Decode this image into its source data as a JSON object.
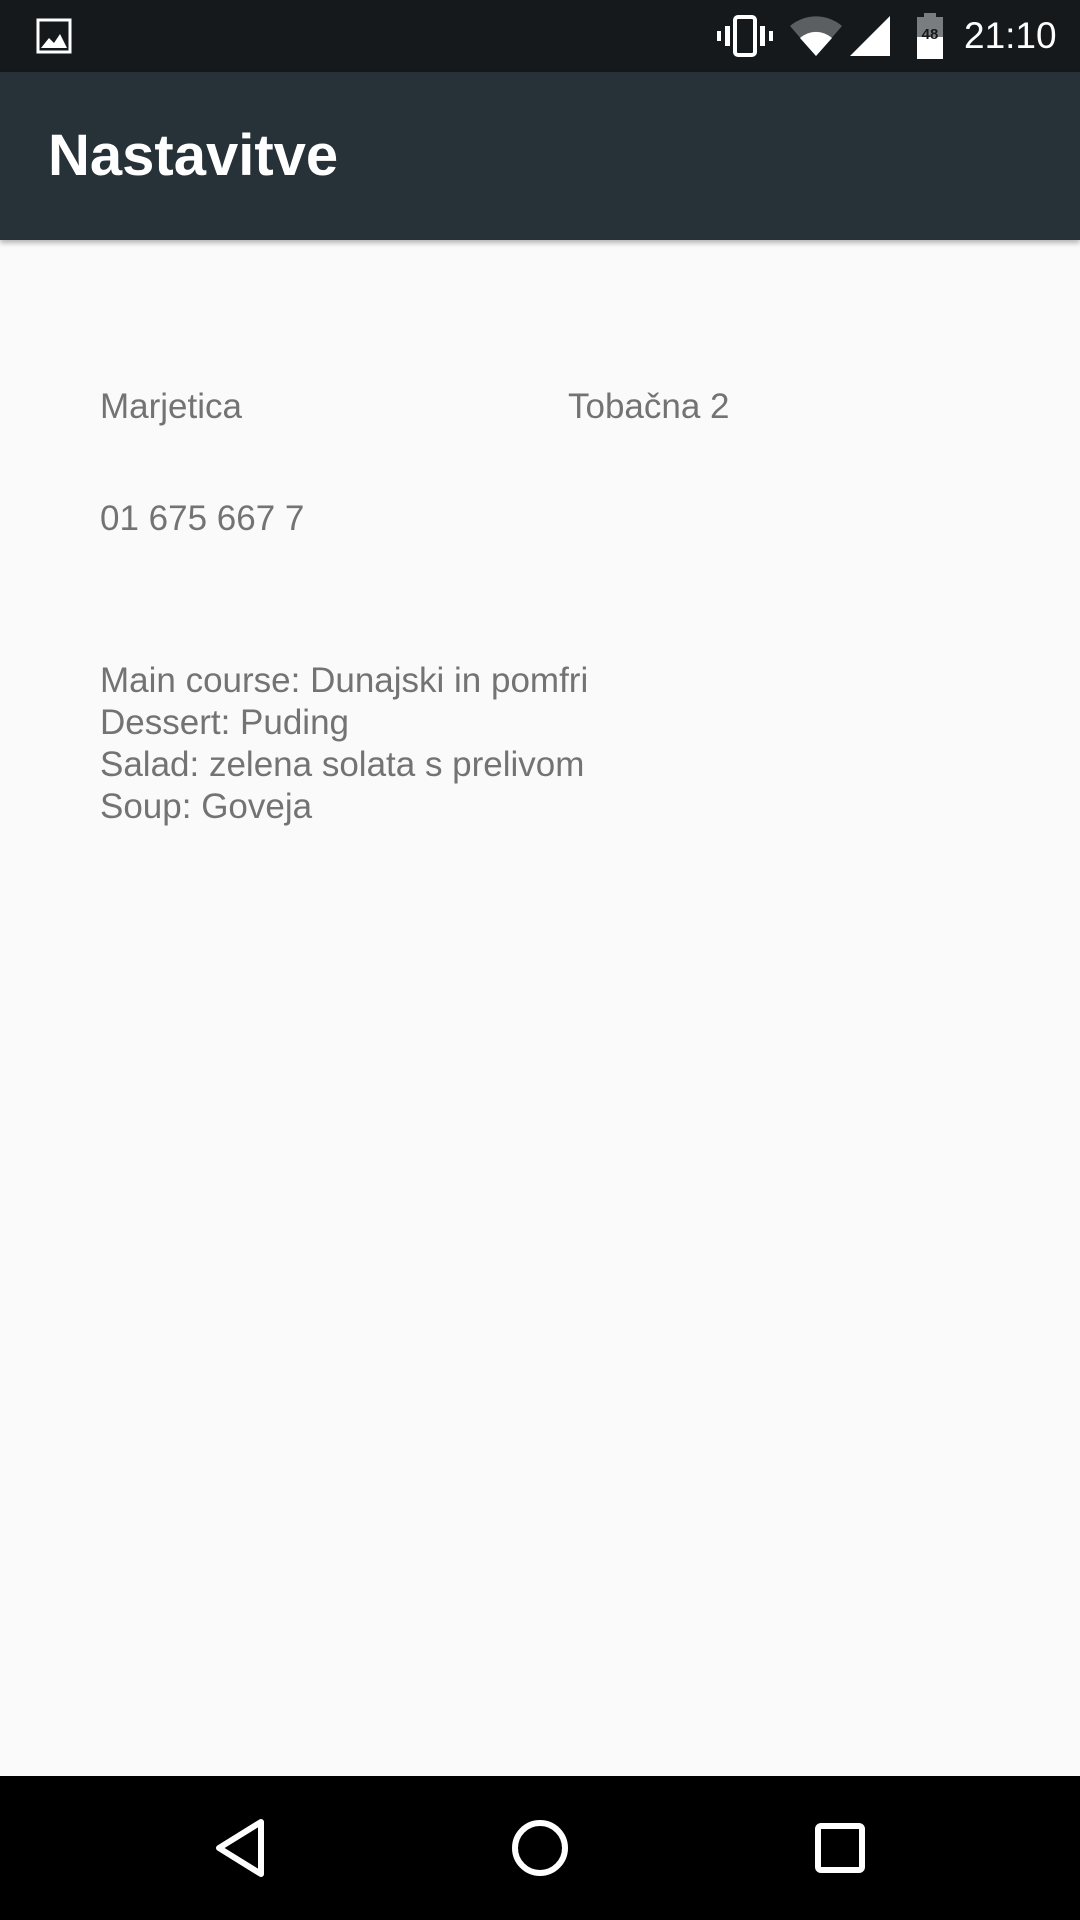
{
  "status_bar": {
    "time": "21:10",
    "battery_level": "48",
    "icons": [
      "gallery-icon",
      "vibrate-icon",
      "wifi-icon",
      "signal-icon",
      "battery-icon"
    ]
  },
  "toolbar": {
    "title": "Nastavitve"
  },
  "restaurant": {
    "name": "Marjetica",
    "address": "Tobačna 2",
    "phone": "01 675 667 7"
  },
  "menu": [
    "Main course: Dunajski in pomfri",
    "Dessert: Puding",
    "Salad: zelena solata s prelivom",
    "Soup: Goveja"
  ],
  "nav_bar": {
    "icons": [
      "back-icon",
      "home-icon",
      "recents-icon"
    ]
  },
  "colors": {
    "status_bar": "#15191c",
    "toolbar": "#263238",
    "background": "#fafafa",
    "text": "#737373",
    "nav_bar": "#000000"
  }
}
